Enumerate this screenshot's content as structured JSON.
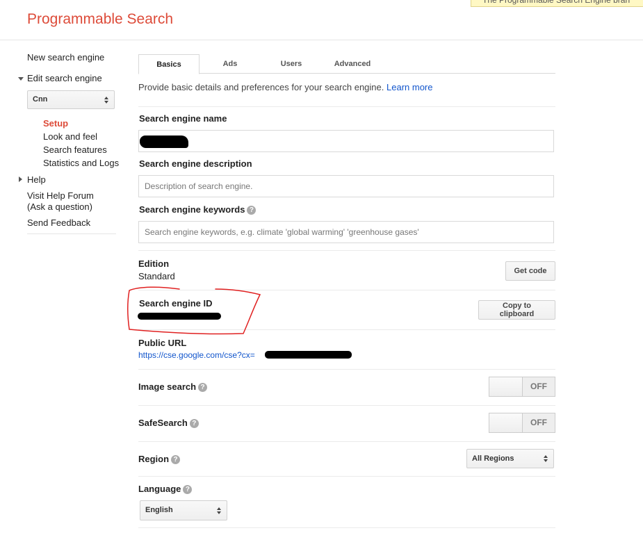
{
  "notice": "The Programmable Search Engine bran",
  "app": {
    "title": "Programmable Search"
  },
  "sidebar": {
    "new_engine": "New search engine",
    "edit_engine": "Edit search engine",
    "engine_select": "Cnn",
    "sub_items": [
      "Setup",
      "Look and feel",
      "Search features",
      "Statistics and Logs"
    ],
    "help": "Help",
    "forum_line1": "Visit Help Forum",
    "forum_line2": "(Ask a question)",
    "feedback": "Send Feedback"
  },
  "tabs": [
    "Basics",
    "Ads",
    "Users",
    "Advanced"
  ],
  "intro": {
    "text": "Provide basic details and preferences for your search engine.",
    "link": "Learn more"
  },
  "fields": {
    "name": {
      "label": "Search engine name",
      "value": ""
    },
    "description": {
      "label": "Search engine description",
      "placeholder": "Description of search engine."
    },
    "keywords": {
      "label": "Search engine keywords",
      "placeholder": "Search engine keywords, e.g. climate 'global warming' 'greenhouse gases'"
    }
  },
  "edition": {
    "label": "Edition",
    "value": "Standard",
    "button": "Get code"
  },
  "engine_id": {
    "label": "Search engine ID",
    "button": "Copy to clipboard"
  },
  "public_url": {
    "label": "Public URL",
    "value": "https://cse.google.com/cse?cx="
  },
  "image_search": {
    "label": "Image search",
    "state": "OFF"
  },
  "safesearch": {
    "label": "SafeSearch",
    "state": "OFF"
  },
  "region": {
    "label": "Region",
    "value": "All Regions"
  },
  "language": {
    "label": "Language",
    "value": "English"
  },
  "colors": {
    "brand": "#dd4b39",
    "link": "#1155cc",
    "annotation": "#e02020"
  }
}
